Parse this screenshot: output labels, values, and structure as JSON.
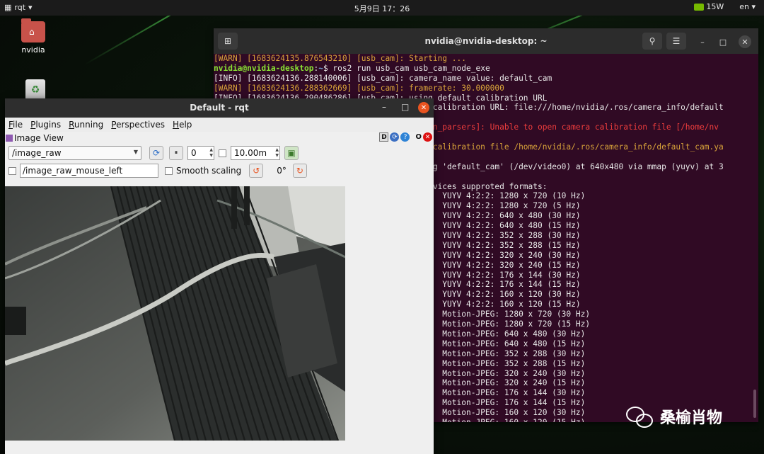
{
  "topbar": {
    "app_name": "rqt",
    "clock": "5月9日  17：26",
    "power": "15W",
    "language": "en"
  },
  "desktop": {
    "home_label": "nvidia"
  },
  "terminal": {
    "title": "nvidia@nvidia-desktop: ~",
    "lines": [
      {
        "segs": [
          {
            "t": "[WARN] [1683624135.876543210] [usb_cam]: Starting ...",
            "c": "c-warn"
          }
        ]
      },
      {
        "segs": [
          {
            "t": "nvidia@nvidia-desktop",
            "c": "c-green"
          },
          {
            "t": ":",
            "c": ""
          },
          {
            "t": "~",
            "c": "c-blue"
          },
          {
            "t": "$ ros2 run usb_cam usb_cam_node_exe",
            "c": ""
          }
        ]
      },
      {
        "segs": [
          {
            "t": "[INFO] [1683624136.288140006] [usb_cam]: camera_name value: default_cam",
            "c": ""
          }
        ]
      },
      {
        "segs": [
          {
            "t": "[WARN] [1683624136.288362669] [usb_cam]: framerate: 30.000000",
            "c": "c-warn"
          }
        ]
      },
      {
        "segs": [
          {
            "t": "[INFO] [1683624136.290486286] [usb_cam]: using default calibration URL",
            "c": ""
          }
        ]
      },
      {
        "segs": [
          {
            "t": "                                          era calibration URL: file:///home/nvidia/.ros/camera_info/default",
            "c": ""
          }
        ]
      },
      {
        "segs": [
          {
            "t": " ",
            "c": ""
          }
        ]
      },
      {
        "segs": [
          {
            "t": "                                          ation_parsers]: Unable to open camera calibration file [/home/nv",
            "c": "c-err"
          }
        ]
      },
      {
        "segs": [
          {
            "t": " ",
            "c": ""
          }
        ]
      },
      {
        "segs": [
          {
            "t": "                                          era calibration file /home/nvidia/.ros/camera_info/default_cam.ya",
            "c": "c-warn"
          }
        ]
      },
      {
        "segs": [
          {
            "t": " ",
            "c": ""
          }
        ]
      },
      {
        "segs": [
          {
            "t": "                                          rting 'default_cam' (/dev/video0) at 640x480 via mmap (yuyv) at 3",
            "c": ""
          }
        ]
      },
      {
        "segs": [
          {
            "t": " ",
            "c": ""
          }
        ]
      },
      {
        "segs": [
          {
            "t": "                                          s devices supproted formats:",
            "c": ""
          }
        ]
      },
      {
        "segs": [
          {
            "t": "                                                YUYV 4:2:2: 1280 x 720 (10 Hz)",
            "c": ""
          }
        ]
      },
      {
        "segs": [
          {
            "t": "                                                YUYV 4:2:2: 1280 x 720 (5 Hz)",
            "c": ""
          }
        ]
      },
      {
        "segs": [
          {
            "t": "                                                YUYV 4:2:2: 640 x 480 (30 Hz)",
            "c": ""
          }
        ]
      },
      {
        "segs": [
          {
            "t": "                                                YUYV 4:2:2: 640 x 480 (15 Hz)",
            "c": ""
          }
        ]
      },
      {
        "segs": [
          {
            "t": "                                                YUYV 4:2:2: 352 x 288 (30 Hz)",
            "c": ""
          }
        ]
      },
      {
        "segs": [
          {
            "t": "                                                YUYV 4:2:2: 352 x 288 (15 Hz)",
            "c": ""
          }
        ]
      },
      {
        "segs": [
          {
            "t": "                                                YUYV 4:2:2: 320 x 240 (30 Hz)",
            "c": ""
          }
        ]
      },
      {
        "segs": [
          {
            "t": "                                                YUYV 4:2:2: 320 x 240 (15 Hz)",
            "c": ""
          }
        ]
      },
      {
        "segs": [
          {
            "t": "                                                YUYV 4:2:2: 176 x 144 (30 Hz)",
            "c": ""
          }
        ]
      },
      {
        "segs": [
          {
            "t": "                                                YUYV 4:2:2: 176 x 144 (15 Hz)",
            "c": ""
          }
        ]
      },
      {
        "segs": [
          {
            "t": "                                                YUYV 4:2:2: 160 x 120 (30 Hz)",
            "c": ""
          }
        ]
      },
      {
        "segs": [
          {
            "t": "                                                YUYV 4:2:2: 160 x 120 (15 Hz)",
            "c": ""
          }
        ]
      },
      {
        "segs": [
          {
            "t": "                                                Motion-JPEG: 1280 x 720 (30 Hz)",
            "c": ""
          }
        ]
      },
      {
        "segs": [
          {
            "t": "                                                Motion-JPEG: 1280 x 720 (15 Hz)",
            "c": ""
          }
        ]
      },
      {
        "segs": [
          {
            "t": "                                                Motion-JPEG: 640 x 480 (30 Hz)",
            "c": ""
          }
        ]
      },
      {
        "segs": [
          {
            "t": "                                                Motion-JPEG: 640 x 480 (15 Hz)",
            "c": ""
          }
        ]
      },
      {
        "segs": [
          {
            "t": "                                                Motion-JPEG: 352 x 288 (30 Hz)",
            "c": ""
          }
        ]
      },
      {
        "segs": [
          {
            "t": "                                                Motion-JPEG: 352 x 288 (15 Hz)",
            "c": ""
          }
        ]
      },
      {
        "segs": [
          {
            "t": "                                                Motion-JPEG: 320 x 240 (30 Hz)",
            "c": ""
          }
        ]
      },
      {
        "segs": [
          {
            "t": "                                                Motion-JPEG: 320 x 240 (15 Hz)",
            "c": ""
          }
        ]
      },
      {
        "segs": [
          {
            "t": "                                                Motion-JPEG: 176 x 144 (30 Hz)",
            "c": ""
          }
        ]
      },
      {
        "segs": [
          {
            "t": "                                                Motion-JPEG: 176 x 144 (15 Hz)",
            "c": ""
          }
        ]
      },
      {
        "segs": [
          {
            "t": "                                                Motion-JPEG: 160 x 120 (30 Hz)",
            "c": ""
          }
        ]
      },
      {
        "segs": [
          {
            "t": "                                                Motion-JPEG: 160 x 120 (15 Hz)",
            "c": ""
          }
        ]
      }
    ]
  },
  "rqt": {
    "title": "Default - rqt",
    "menu": [
      "File",
      "Plugins",
      "Running",
      "Perspectives",
      "Help"
    ],
    "plugin_title": "Image View",
    "plugin_status": "D",
    "plugin_close": "O",
    "topic": "/image_raw",
    "spin_value": "0",
    "time_value": "10.00m",
    "mouse_topic": "/image_raw_mouse_left",
    "smooth_label": "Smooth scaling",
    "rotation": "0°"
  },
  "watermark": "桑榆肖物",
  "colors": {
    "terminal_bg": "#300a24",
    "prompt_green": "#8ae234",
    "warn": "#d9a43a",
    "error": "#ef3d3d",
    "accent_orange": "#e95420"
  }
}
